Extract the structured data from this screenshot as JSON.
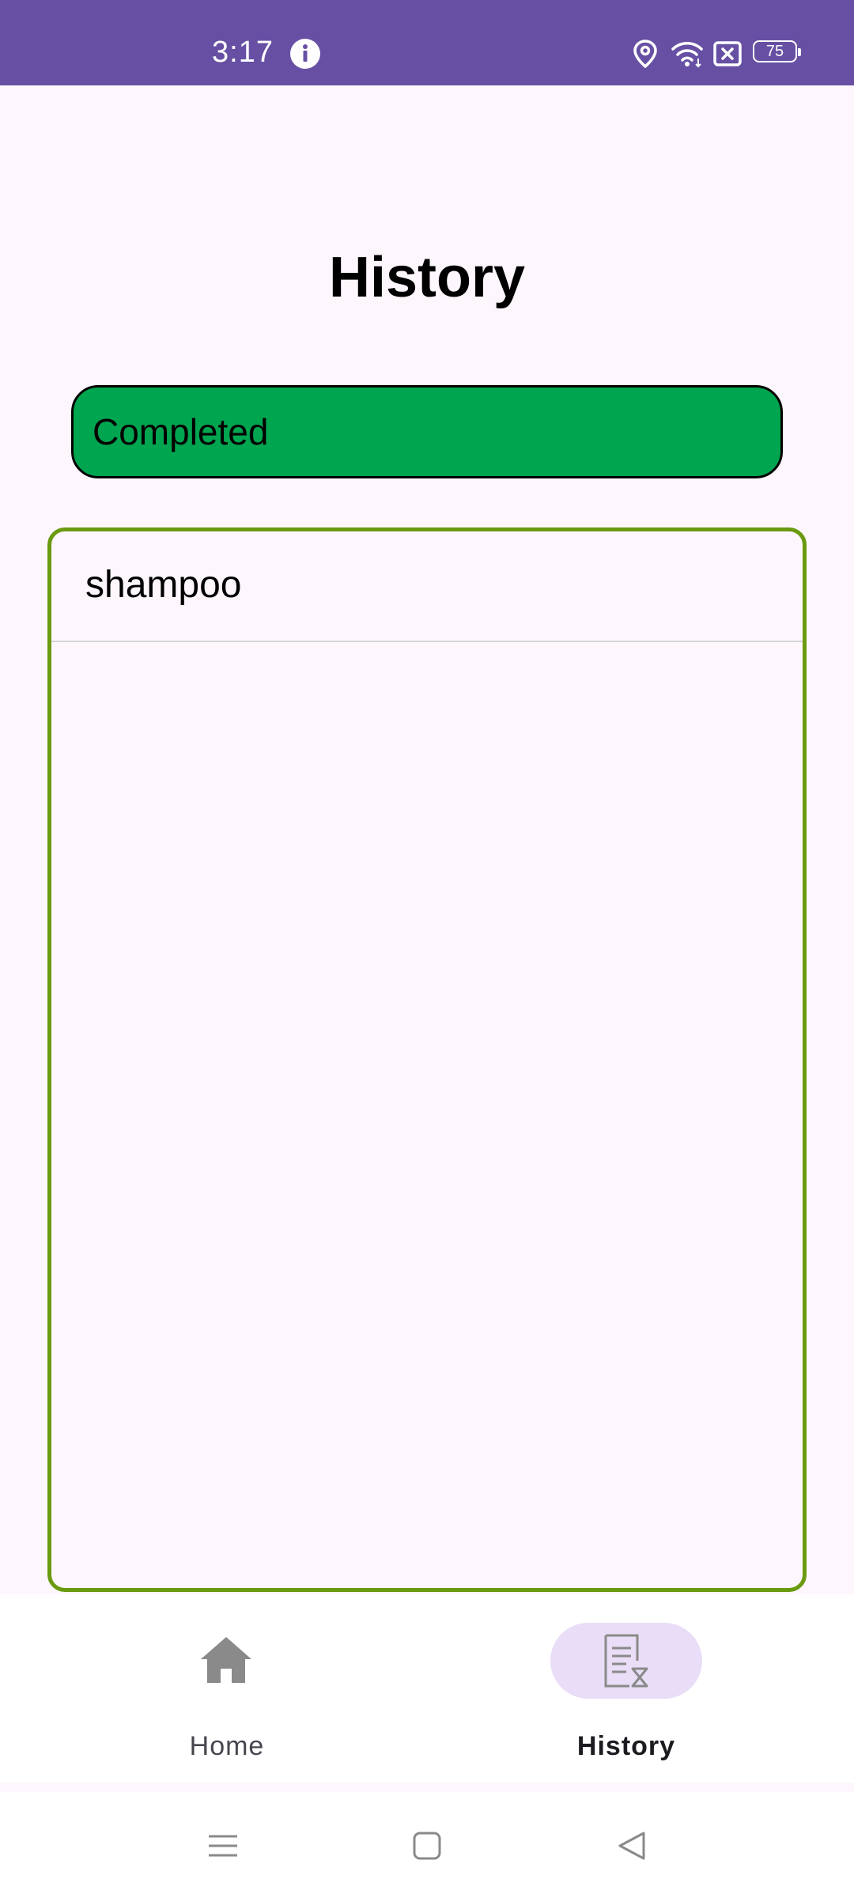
{
  "status_bar": {
    "time": "3:17",
    "battery": "75",
    "bg_color": "#6750a4",
    "icons": [
      "info-icon",
      "location-icon",
      "wifi-icon",
      "sim-icon",
      "battery-icon"
    ]
  },
  "page": {
    "title": "History"
  },
  "filter": {
    "label": "Completed",
    "color": "#00a550"
  },
  "history_list": {
    "border_color": "#6a9a10",
    "items": [
      {
        "label": "shampoo"
      }
    ]
  },
  "bottom_nav": {
    "items": [
      {
        "label": "Home",
        "icon": "home-icon",
        "selected": false
      },
      {
        "label": "History",
        "icon": "history-document-icon",
        "selected": true
      }
    ],
    "indicator_color": "#e9ddf7"
  },
  "system_nav": {
    "buttons": [
      "menu-icon",
      "home-square-icon",
      "back-triangle-icon"
    ]
  }
}
